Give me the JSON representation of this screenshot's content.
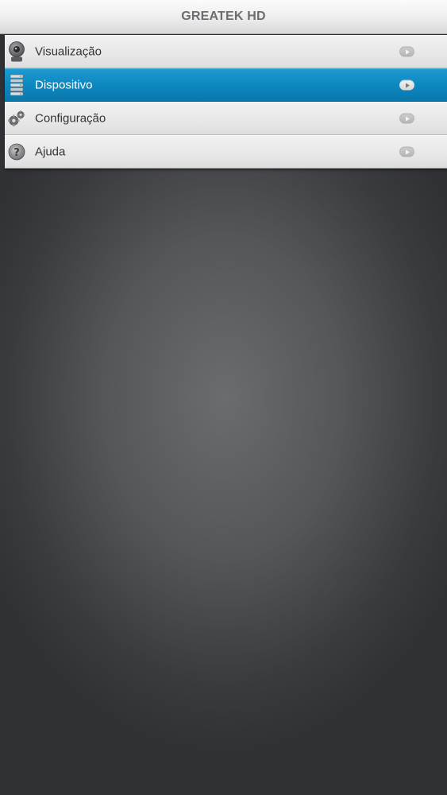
{
  "header": {
    "title": "GREATEK HD"
  },
  "menu": {
    "items": [
      {
        "label": "Visualização",
        "icon": "camera-icon",
        "selected": false
      },
      {
        "label": "Dispositivo",
        "icon": "device-list-icon",
        "selected": true
      },
      {
        "label": "Configuração",
        "icon": "gears-icon",
        "selected": false
      },
      {
        "label": "Ajuda",
        "icon": "help-icon",
        "selected": false
      }
    ]
  },
  "colors": {
    "selected_row": "#0d88bf",
    "title_text": "#6d6d6f",
    "background": "#55565a"
  }
}
